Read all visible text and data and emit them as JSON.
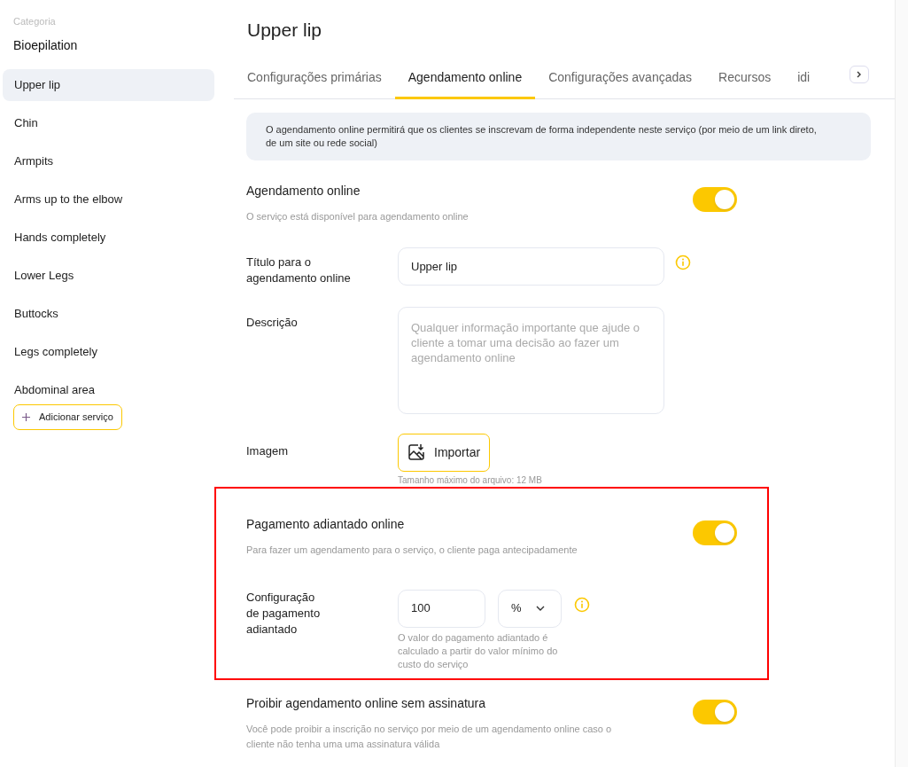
{
  "sidebar": {
    "caption": "Categoria",
    "category": "Bioepilation",
    "items": [
      {
        "label": "Upper lip",
        "selected": true
      },
      {
        "label": "Chin",
        "selected": false
      },
      {
        "label": "Armpits",
        "selected": false
      },
      {
        "label": "Arms up to the elbow",
        "selected": false
      },
      {
        "label": "Hands completely",
        "selected": false
      },
      {
        "label": "Lower Legs",
        "selected": false
      },
      {
        "label": "Buttocks",
        "selected": false
      },
      {
        "label": "Legs completely",
        "selected": false
      },
      {
        "label": "Abdominal area",
        "selected": false
      }
    ],
    "add_button": "Adicionar serviço"
  },
  "page_title": "Upper lip",
  "tabs": [
    {
      "label": "Configurações primárias",
      "selected": false
    },
    {
      "label": "Agendamento online",
      "selected": true
    },
    {
      "label": "Configurações avançadas",
      "selected": false
    },
    {
      "label": "Recursos",
      "selected": false
    },
    {
      "label": "idi",
      "selected": false
    }
  ],
  "notice": "O agendamento online permitirá que os clientes se inscrevam de forma independente neste serviço (por meio de um link direto, de um site ou rede social)",
  "online_booking": {
    "title": "Agendamento online",
    "description": "O serviço está disponível para agendamento online",
    "on": true
  },
  "booking_title": {
    "label": "Título para o agendamento online",
    "value": "Upper lip"
  },
  "description": {
    "label": "Descrição",
    "placeholder": "Qualquer informação importante que ajude o cliente a tomar uma decisão ao fazer um agendamento online"
  },
  "image": {
    "label": "Imagem",
    "button": "Importar",
    "hint": "Tamanho máximo do arquivo: 12 MB"
  },
  "prepayment": {
    "highlighted": true,
    "title": "Pagamento adiantado online",
    "description": "Para fazer um agendamento para o serviço, o cliente paga antecipadamente",
    "on": true,
    "config_label": "Configuração de pagamento adiantado",
    "amount": "100",
    "unit": "%",
    "hint": "O valor do pagamento adiantado é calculado a partir do valor mínimo do custo do serviço"
  },
  "no_subscription": {
    "title": "Proibir agendamento online sem assinatura",
    "description": "Você pode proibir a inscrição no serviço por meio de um agendamento online caso o cliente não tenha uma uma assinatura válida",
    "on": true
  }
}
